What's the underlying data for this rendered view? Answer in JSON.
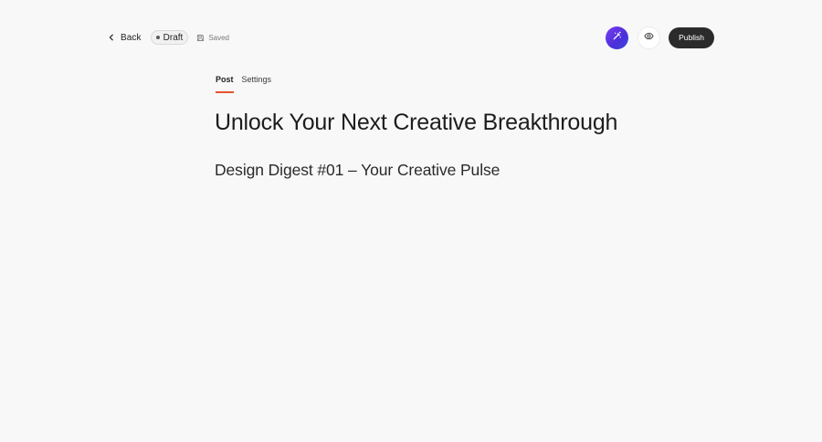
{
  "header": {
    "back_label": "Back",
    "status_label": "Draft",
    "saved_label": "Saved",
    "publish_label": "Publish",
    "ai_icon": "magic-wand-icon",
    "preview_icon": "eye-icon",
    "accent_ai": "#5b35e6",
    "publish_bg": "#2b2b2b"
  },
  "tabs": [
    {
      "label": "Post",
      "active": true
    },
    {
      "label": "Settings",
      "active": false
    }
  ],
  "tab_accent": "#e5532f",
  "post": {
    "title": "Unlock Your Next Creative Breakthrough",
    "subtitle": "Design Digest #01 – Your Creative Pulse"
  }
}
